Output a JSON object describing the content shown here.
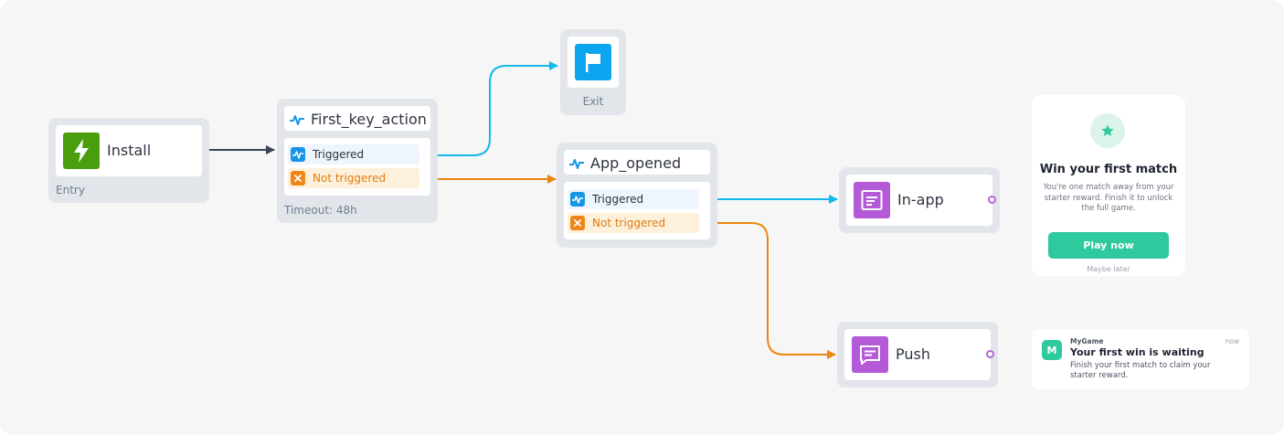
{
  "colors": {
    "background": "#f6f6f7",
    "node_frame": "#e2e5ea",
    "install_green": "#4a9d0c",
    "exit_blue": "#0ea5f0",
    "message_purple": "#b45ad9",
    "triggered_blue": "#12b8ea",
    "not_triggered_orange": "#e98710",
    "entry_connector": "#3a4556",
    "accent_green": "#2ec99c"
  },
  "nodes": {
    "install": {
      "label": "Install",
      "subtitle": "Entry",
      "icon": "lightning-bolt-icon"
    },
    "first_key_action": {
      "label": "First_key_action",
      "icon": "activity-pulse-icon",
      "triggered": "Triggered",
      "not_triggered": "Not triggered",
      "subtitle": "Timeout: 48h"
    },
    "exit": {
      "label": "Exit",
      "icon": "flag-icon"
    },
    "app_opened": {
      "label": "App_opened",
      "icon": "activity-pulse-icon",
      "triggered": "Triggered",
      "not_triggered": "Not triggered"
    },
    "in_app": {
      "label": "In-app",
      "icon": "in-app-message-icon"
    },
    "push": {
      "label": "Push",
      "icon": "push-message-icon"
    }
  },
  "in_app_preview": {
    "icon": "star-icon",
    "title": "Win your first match",
    "body": "You're one match away from your starter reward. Finish it to unlock the full game.",
    "button": "Play now",
    "secondary": "Maybe later"
  },
  "push_preview": {
    "app_initial": "M",
    "app_name": "MyGame",
    "time": "now",
    "title": "Your first win is waiting",
    "body": "Finish your first match to claim your starter reward."
  }
}
